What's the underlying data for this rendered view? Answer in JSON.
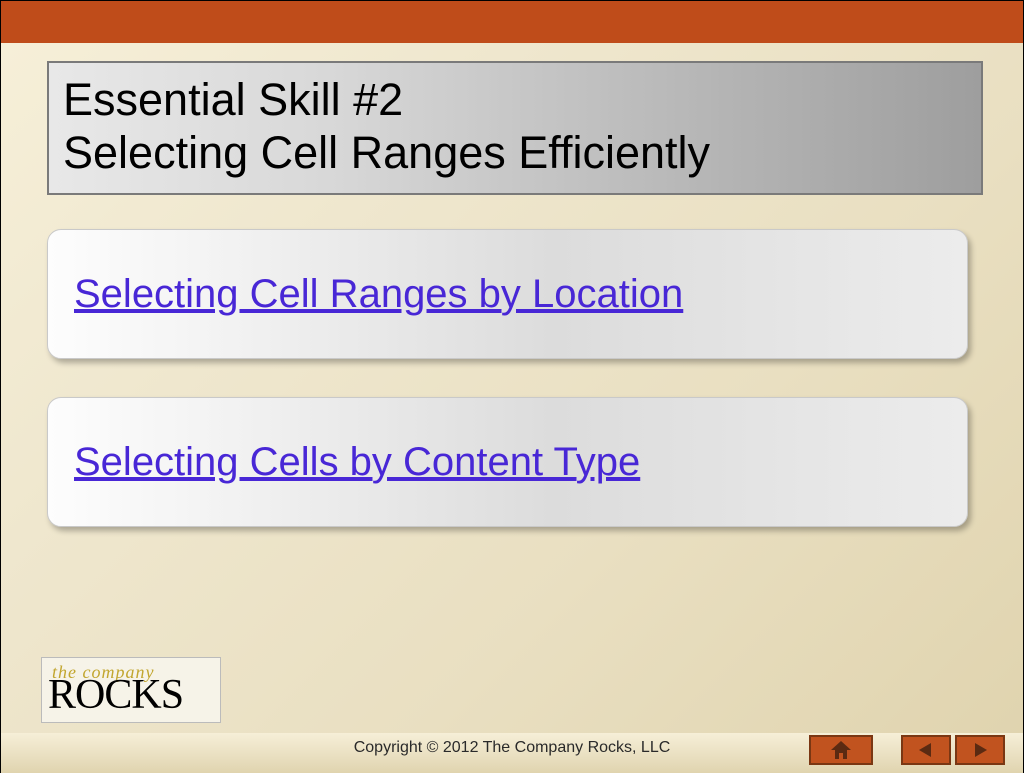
{
  "title": {
    "line1": "Essential Skill #2",
    "line2": "Selecting Cell Ranges Efficiently"
  },
  "links": [
    {
      "label": "Selecting Cell Ranges by Location"
    },
    {
      "label": "Selecting Cells by Content Type"
    }
  ],
  "logo": {
    "top": "the company",
    "bottom": "ROCKS"
  },
  "footer": {
    "copyright": "Copyright © 2012 The Company Rocks, LLC"
  },
  "nav": {
    "home": "home-icon",
    "prev": "prev-icon",
    "next": "next-icon"
  }
}
